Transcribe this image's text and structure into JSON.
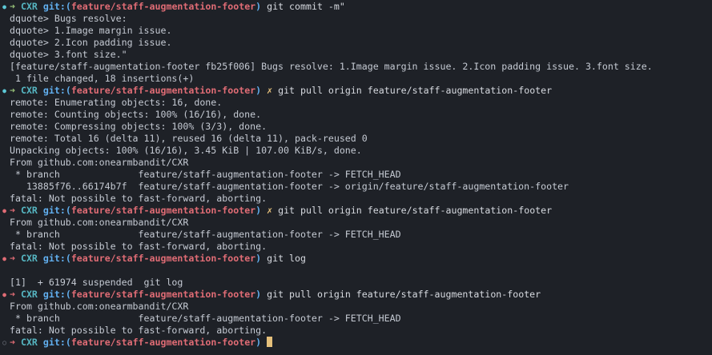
{
  "prompt": {
    "arrow": "➜",
    "dir": "CXR",
    "git_open": "git:(",
    "branch": "feature/staff-augmentation-footer",
    "git_close": ")",
    "dirty_mark": "✗"
  },
  "colors": {
    "background": "#1e2127",
    "text": "#c5cad3",
    "dir": "#56b6c2",
    "git": "#61afef",
    "branch": "#e06c75",
    "arrow_ok": "#98c379",
    "arrow_err": "#e06c75",
    "dirty": "#e5c07b",
    "cursor": "#e5c07b"
  },
  "lines": [
    {
      "type": "prompt",
      "status": "ok",
      "dirty": false,
      "cmd": " git commit -m\""
    },
    {
      "type": "output",
      "text": "dquote> Bugs resolve:"
    },
    {
      "type": "output",
      "text": "dquote> 1.Image margin issue."
    },
    {
      "type": "output",
      "text": "dquote> 2.Icon padding issue."
    },
    {
      "type": "output",
      "text": "dquote> 3.font size.\""
    },
    {
      "type": "output",
      "text": "[feature/staff-augmentation-footer fb25f006] Bugs resolve: 1.Image margin issue. 2.Icon padding issue. 3.font size."
    },
    {
      "type": "output",
      "text": " 1 file changed, 18 insertions(+)"
    },
    {
      "type": "prompt",
      "status": "ok",
      "dirty": true,
      "cmd": " git pull origin feature/staff-augmentation-footer"
    },
    {
      "type": "output",
      "text": "remote: Enumerating objects: 16, done."
    },
    {
      "type": "output",
      "text": "remote: Counting objects: 100% (16/16), done."
    },
    {
      "type": "output",
      "text": "remote: Compressing objects: 100% (3/3), done."
    },
    {
      "type": "output",
      "text": "remote: Total 16 (delta 11), reused 16 (delta 11), pack-reused 0"
    },
    {
      "type": "output",
      "text": "Unpacking objects: 100% (16/16), 3.45 KiB | 107.00 KiB/s, done."
    },
    {
      "type": "output",
      "text": "From github.com:onearmbandit/CXR"
    },
    {
      "type": "output",
      "text": " * branch              feature/staff-augmentation-footer -> FETCH_HEAD"
    },
    {
      "type": "output",
      "text": "   13885f76..66174b7f  feature/staff-augmentation-footer -> origin/feature/staff-augmentation-footer"
    },
    {
      "type": "output",
      "text": "fatal: Not possible to fast-forward, aborting."
    },
    {
      "type": "prompt",
      "status": "err",
      "dirty": true,
      "cmd": " git pull origin feature/staff-augmentation-footer"
    },
    {
      "type": "output",
      "text": "From github.com:onearmbandit/CXR"
    },
    {
      "type": "output",
      "text": " * branch              feature/staff-augmentation-footer -> FETCH_HEAD"
    },
    {
      "type": "output",
      "text": "fatal: Not possible to fast-forward, aborting."
    },
    {
      "type": "prompt",
      "status": "err",
      "dirty": false,
      "cmd": " git log"
    },
    {
      "type": "output",
      "text": ""
    },
    {
      "type": "output",
      "text": "[1]  + 61974 suspended  git log"
    },
    {
      "type": "prompt",
      "status": "err",
      "dirty": false,
      "cmd": " git pull origin feature/staff-augmentation-footer"
    },
    {
      "type": "output",
      "text": "From github.com:onearmbandit/CXR"
    },
    {
      "type": "output",
      "text": " * branch              feature/staff-augmentation-footer -> FETCH_HEAD"
    },
    {
      "type": "output",
      "text": "fatal: Not possible to fast-forward, aborting."
    },
    {
      "type": "prompt",
      "status": "err",
      "dirty": false,
      "cmd": " ",
      "active": true
    }
  ]
}
